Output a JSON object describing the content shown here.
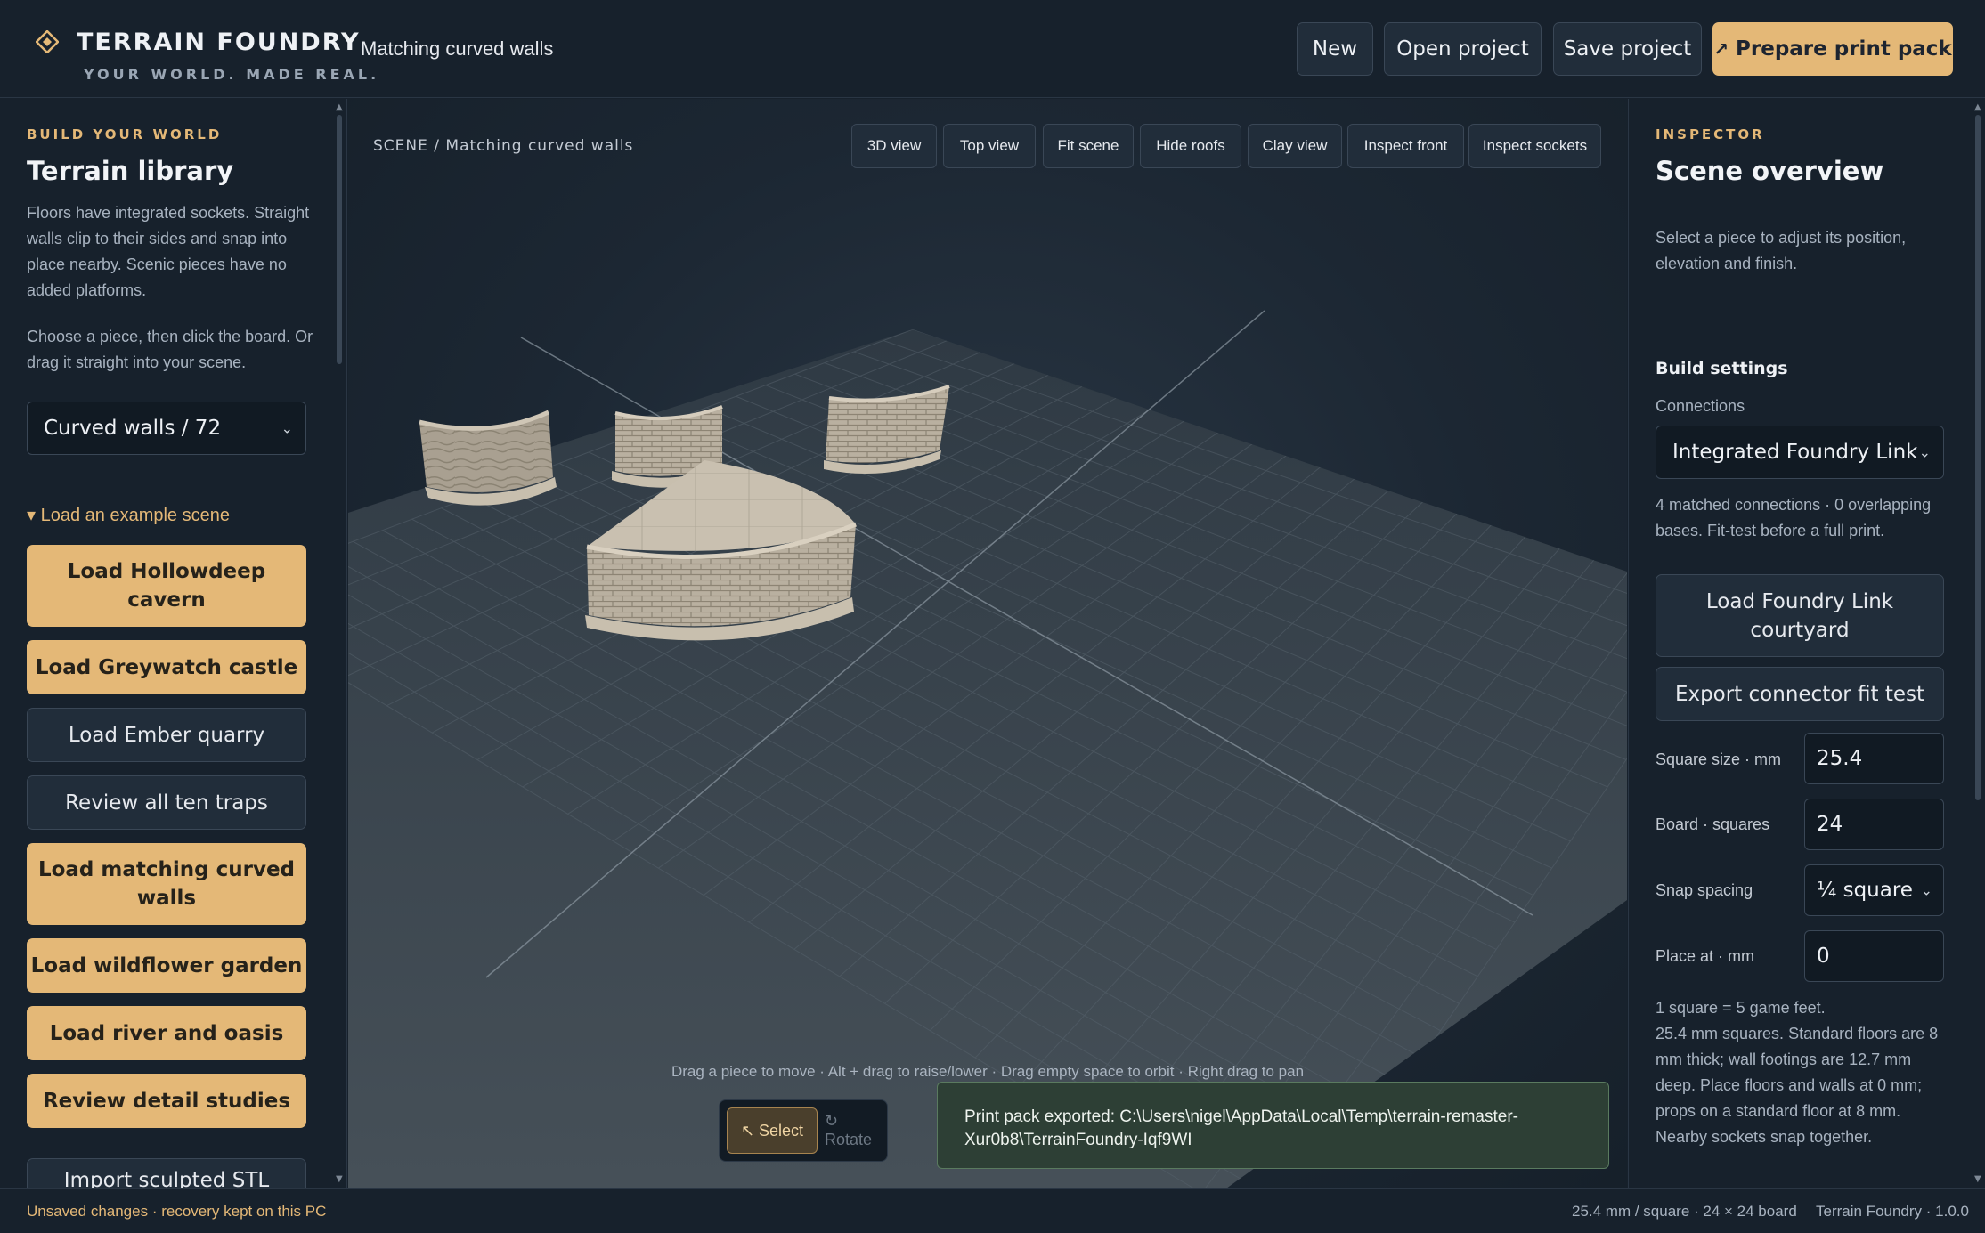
{
  "header": {
    "brand": "TERRAIN FOUNDRY",
    "tagline": "YOUR WORLD. MADE REAL.",
    "document_title": "Matching curved walls",
    "buttons": {
      "new": "New",
      "open": "Open project",
      "save": "Save project",
      "prepare": "Prepare print pack"
    }
  },
  "library": {
    "eyebrow": "BUILD YOUR WORLD",
    "title": "Terrain library",
    "description": "Floors have integrated sockets. Straight walls clip to their sides and snap into place nearby. Scenic pieces have no added platforms.",
    "instructions": "Choose a piece, then click the board. Or drag it straight into your scene.",
    "category_select": "Curved walls / 72",
    "examples_toggle": "▾ Load an example scene",
    "examples": [
      {
        "label": "Load Hollowdeep cavern",
        "style": "gold"
      },
      {
        "label": "Load Greywatch castle",
        "style": "gold"
      },
      {
        "label": "Load Ember quarry",
        "style": "dark"
      },
      {
        "label": "Review all ten traps",
        "style": "dark"
      },
      {
        "label": "Load matching curved walls",
        "style": "gold"
      },
      {
        "label": "Load wildflower garden",
        "style": "gold"
      },
      {
        "label": "Load river and oasis",
        "style": "gold"
      },
      {
        "label": "Review detail studies",
        "style": "gold"
      }
    ],
    "import_button": "Import sculpted STL"
  },
  "viewport": {
    "breadcrumb": "SCENE / Matching curved walls",
    "view_buttons": [
      "3D view",
      "Top view",
      "Fit scene",
      "Hide roofs",
      "Clay view",
      "Inspect front",
      "Inspect sockets"
    ],
    "hint": "Drag a piece to move · Alt + drag to raise/lower · Drag empty space to orbit · Right drag to pan",
    "tools": {
      "select": "↖ Select",
      "rotate": "↻ Rotate"
    },
    "toast": "Print pack exported: C:\\Users\\nigel\\AppData\\Local\\Temp\\terrain-remaster-Xur0b8\\TerrainFoundry-Iqf9WI"
  },
  "inspector": {
    "eyebrow": "INSPECTOR",
    "title": "Scene overview",
    "description": "Select a piece to adjust its position, elevation and finish.",
    "build_settings_title": "Build settings",
    "connections_label": "Connections",
    "connections_value": "Integrated Foundry Link",
    "connections_status": "4 matched connections · 0 overlapping bases. Fit-test before a full print.",
    "load_courtyard": "Load Foundry Link courtyard",
    "export_fit_test": "Export connector fit test",
    "fields": {
      "square_size": {
        "label": "Square size · mm",
        "value": "25.4"
      },
      "board": {
        "label": "Board · squares",
        "value": "24"
      },
      "snap": {
        "label": "Snap spacing",
        "value": "¼ square"
      },
      "place_at": {
        "label": "Place at · mm",
        "value": "0"
      }
    },
    "notes": "1 square = 5 game feet.\n25.4 mm squares. Standard floors are 8 mm thick; wall footings are 12.7 mm deep. Place floors and walls at 0 mm; props on a standard floor at 8 mm. Nearby sockets snap together."
  },
  "status": {
    "left": "Unsaved changes · recovery kept on this PC",
    "board_info": "25.4 mm / square · 24 × 24 board",
    "version": "Terrain Foundry · 1.0.0"
  },
  "colors": {
    "accent": "#e4b877",
    "background": "#17212c",
    "panel_button": "#212d3a",
    "toast_bg": "#2d3f35"
  }
}
